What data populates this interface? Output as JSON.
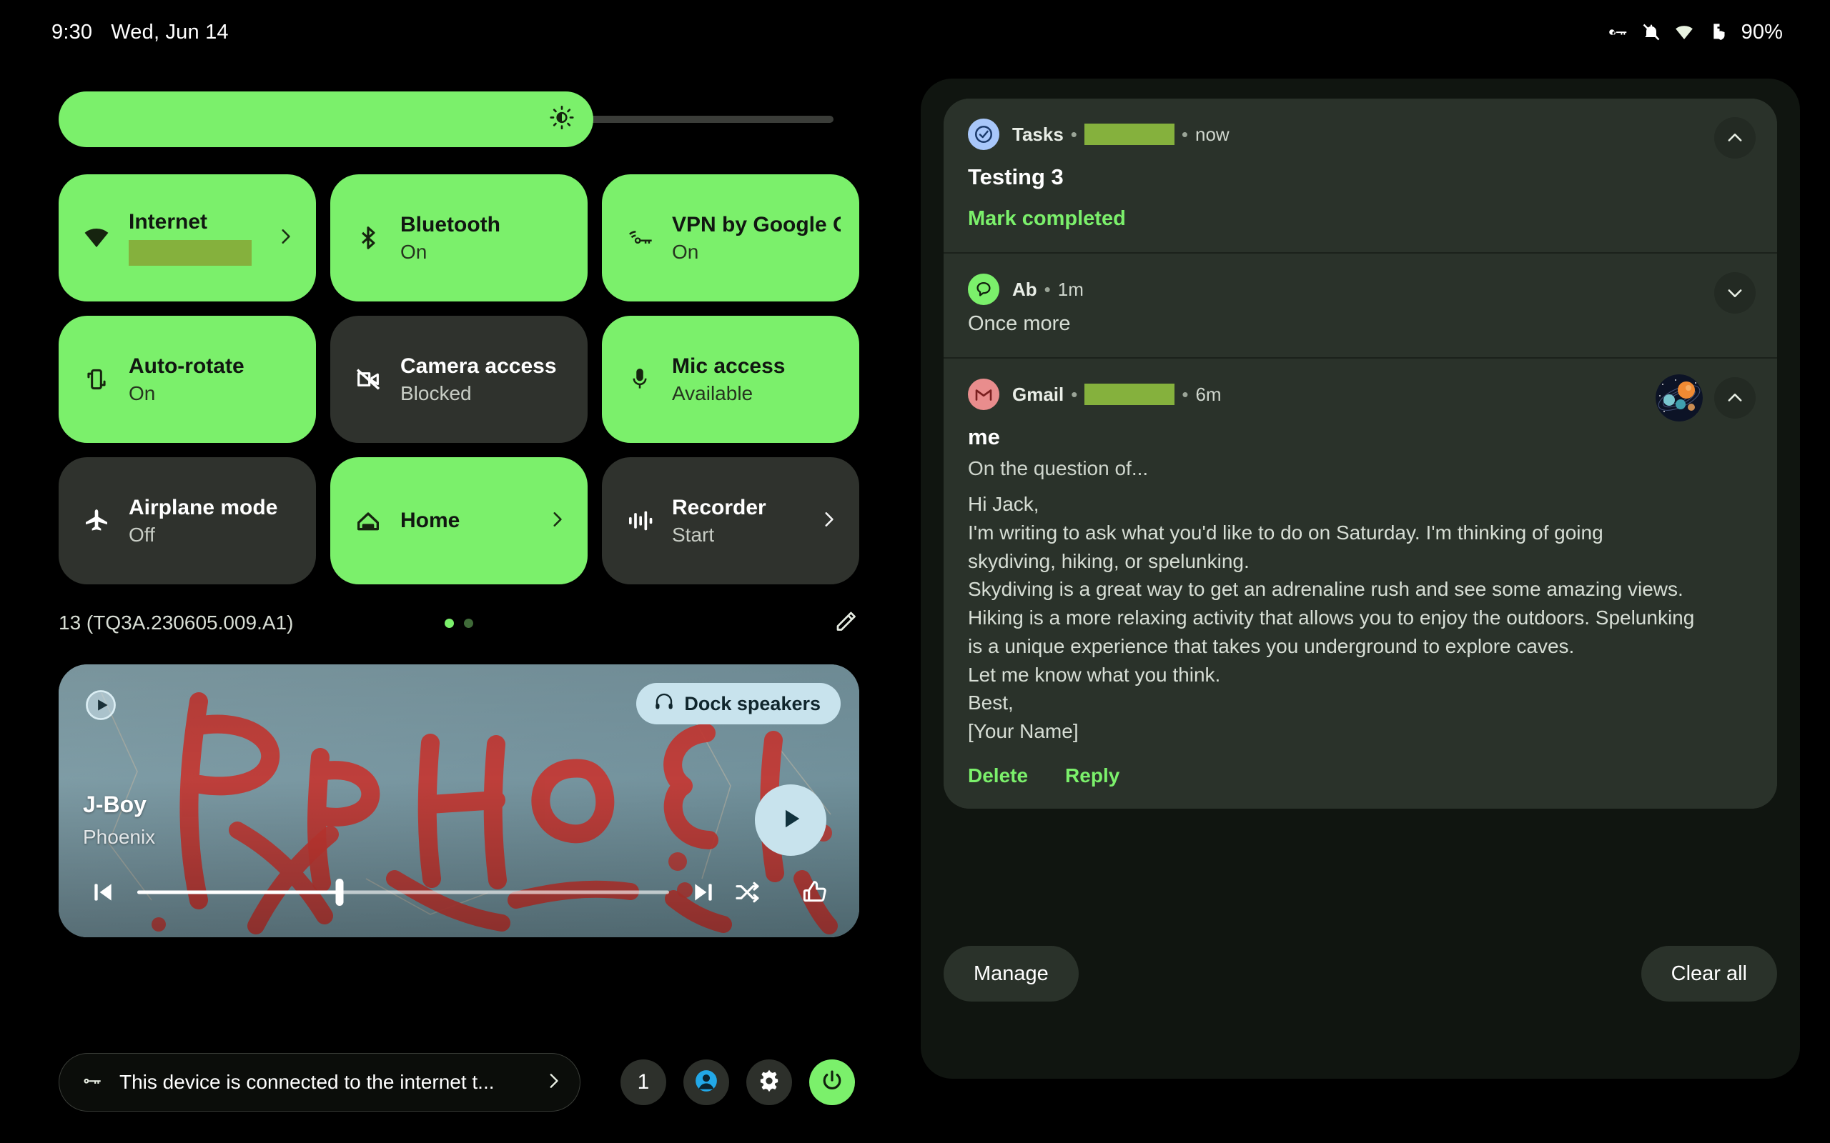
{
  "statusbar": {
    "clock": "9:30",
    "date": "Wed, Jun 14",
    "battery_percent": "90%",
    "icons": [
      "vpn-key-icon",
      "notifications-off-icon",
      "wifi-icon",
      "battery-shield-icon"
    ]
  },
  "brightness": {
    "label": "Brightness",
    "level_percent": 69,
    "icon": "brightness-icon"
  },
  "tiles": [
    {
      "label": "Internet",
      "sub": "",
      "sub_redacted": true,
      "state": "on",
      "icon": "wifi-icon",
      "chevron": true
    },
    {
      "label": "Bluetooth",
      "sub": "On",
      "sub_redacted": false,
      "state": "on",
      "icon": "bluetooth-icon",
      "chevron": false
    },
    {
      "label": "VPN by Google One",
      "sub": "On",
      "sub_redacted": false,
      "state": "on",
      "icon": "vpn-key-icon",
      "chevron": false
    },
    {
      "label": "Auto-rotate",
      "sub": "On",
      "sub_redacted": false,
      "state": "on",
      "icon": "auto-rotate-icon",
      "chevron": false
    },
    {
      "label": "Camera access",
      "sub": "Blocked",
      "sub_redacted": false,
      "state": "off",
      "icon": "camera-off-icon",
      "chevron": false
    },
    {
      "label": "Mic access",
      "sub": "Available",
      "sub_redacted": false,
      "state": "on",
      "icon": "microphone-icon",
      "chevron": false
    },
    {
      "label": "Airplane mode",
      "sub": "Off",
      "sub_redacted": false,
      "state": "off",
      "icon": "airplane-icon",
      "chevron": false
    },
    {
      "label": "Home",
      "sub": "",
      "sub_redacted": false,
      "state": "on",
      "icon": "home-icon",
      "chevron": true
    },
    {
      "label": "Recorder",
      "sub": "Start",
      "sub_redacted": false,
      "state": "off",
      "icon": "recorder-icon",
      "chevron": true
    }
  ],
  "build": {
    "version": "13 (TQ3A.230605.009.A1)",
    "pages": 2,
    "active_page": 1,
    "edit_icon": "pencil-edit-icon"
  },
  "media": {
    "app_badge_icon": "media-play-badge-icon",
    "output_chip": {
      "label": "Dock speakers",
      "icon": "headphones-icon"
    },
    "title": "J-Boy",
    "artist": "Phoenix",
    "play_icon": "play-icon",
    "progress_percent": 38,
    "controls": [
      "skip-previous-icon",
      "skip-next-icon",
      "shuffle-icon",
      "thumbs-up-icon"
    ]
  },
  "device_chip": {
    "icon": "vpn-key-icon",
    "text": "This device is connected to the internet t...",
    "chevron": "chevron-right-icon"
  },
  "footer": {
    "count_badge": "1",
    "user_icon": "user-avatar-icon",
    "settings_icon": "gear-icon",
    "power_icon": "power-icon"
  },
  "notifications": [
    {
      "app": "Tasks",
      "app_icon": "tasks-check-icon",
      "redacted_account": true,
      "time": "now",
      "title": "Testing 3",
      "action": "Mark completed",
      "expand_icon": "chevron-up-icon",
      "expanded": true
    },
    {
      "app": "Ab",
      "app_icon": "messages-bubble-icon",
      "redacted_account": false,
      "time": "1m",
      "message": "Once more",
      "expand_icon": "chevron-down-icon",
      "expanded": false
    },
    {
      "app": "Gmail",
      "app_icon": "gmail-m-icon",
      "redacted_account": true,
      "time": "6m",
      "sender": "me",
      "subject": "On the question of...",
      "avatar_icon": "planets-avatar-icon",
      "body_lines": [
        "Hi Jack,",
        "I'm writing to ask what you'd like to do on Saturday. I'm thinking of going",
        "skydiving, hiking, or spelunking.",
        "Skydiving is a great way to get an adrenaline rush and see some amazing views.",
        "Hiking is a more relaxing activity that allows you to enjoy the outdoors. Spelunking",
        "is a unique experience that takes you underground to explore caves.",
        "Let me know what you think.",
        "Best,",
        "[Your Name]"
      ],
      "actions": [
        "Delete",
        "Reply"
      ],
      "expand_icon": "chevron-up-icon",
      "expanded": true
    }
  ],
  "panel_footer": {
    "manage_label": "Manage",
    "clear_all_label": "Clear all"
  },
  "colors": {
    "accent_green": "#7bf06b",
    "tile_off": "#2f322d",
    "panel_bg": "#101510",
    "notif_bg": "#2a322a",
    "redact_green": "#85b13d"
  }
}
